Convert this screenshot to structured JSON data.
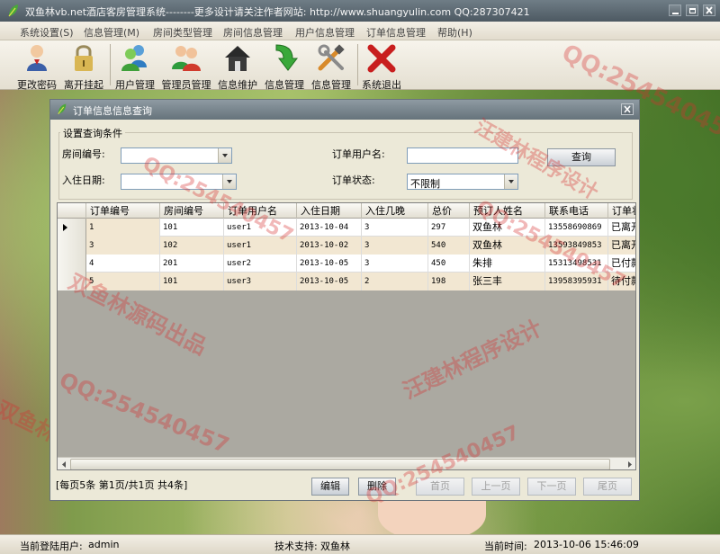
{
  "window": {
    "title": "双鱼林vb.net酒店客房管理系统--------更多设计请关注作者网站: http://www.shuangyulin.com   QQ:287307421"
  },
  "menu": [
    "系统设置(S)",
    "信息管理(M)",
    "房间类型管理",
    "房间信息管理",
    "用户信息管理",
    "订单信息管理",
    "帮助(H)"
  ],
  "toolbar": [
    {
      "label": "更改密码",
      "icon": "user-key-icon"
    },
    {
      "label": "离开挂起",
      "icon": "padlock-icon"
    },
    {
      "label": "用户管理",
      "icon": "users-icon"
    },
    {
      "label": "管理员管理",
      "icon": "admins-icon"
    },
    {
      "label": "信息维护",
      "icon": "house-icon"
    },
    {
      "label": "信息管理",
      "icon": "green-arrow-icon"
    },
    {
      "label": "信息管理",
      "icon": "tools-icon"
    },
    {
      "label": "系统退出",
      "icon": "red-x-icon"
    }
  ],
  "dialog": {
    "title": "订单信息信息查询",
    "group_label": "设置查询条件",
    "room_no_label": "房间编号:",
    "room_no_value": "",
    "checkin_date_label": "入住日期:",
    "checkin_date_value": "",
    "order_user_label": "订单用户名:",
    "order_user_value": "",
    "order_status_label": "订单状态:",
    "order_status_value": "不限制",
    "query_button": "查询"
  },
  "table": {
    "headers": [
      "订单编号",
      "房间编号",
      "订单用户名",
      "入住日期",
      "入住几晚",
      "总价",
      "预订人姓名",
      "联系电话",
      "订单状态"
    ],
    "rows": [
      [
        "1",
        "101",
        "user1",
        "2013-10-04",
        "3",
        "297",
        "双鱼林",
        "13558690869",
        "已离开"
      ],
      [
        "3",
        "102",
        "user1",
        "2013-10-02",
        "3",
        "540",
        "双鱼林",
        "13593849853",
        "已离开"
      ],
      [
        "4",
        "201",
        "user2",
        "2013-10-05",
        "3",
        "450",
        "朱排",
        "15313498531",
        "已付款"
      ],
      [
        "5",
        "101",
        "user3",
        "2013-10-05",
        "2",
        "198",
        "张三丰",
        "13958395931",
        "待付款"
      ]
    ]
  },
  "pagination": {
    "info": "[每页5条  第1页/共1页   共4条]",
    "edit": "编辑",
    "delete": "删除",
    "first": "首页",
    "prev": "上一页",
    "next": "下一页",
    "last": "尾页"
  },
  "status": {
    "user_label": "当前登陆用户:",
    "user": "admin",
    "support_label": "技术支持:",
    "support": "双鱼林",
    "time_label": "当前时间:",
    "time": "2013-10-06 15:46:09"
  },
  "watermarks": {
    "qq": "QQ:254540457",
    "source": "双鱼林源码出品",
    "design": "汪建林程序设计"
  },
  "colors": {
    "selected_cell": "#f2e7d2",
    "watermark": "#d63030"
  }
}
